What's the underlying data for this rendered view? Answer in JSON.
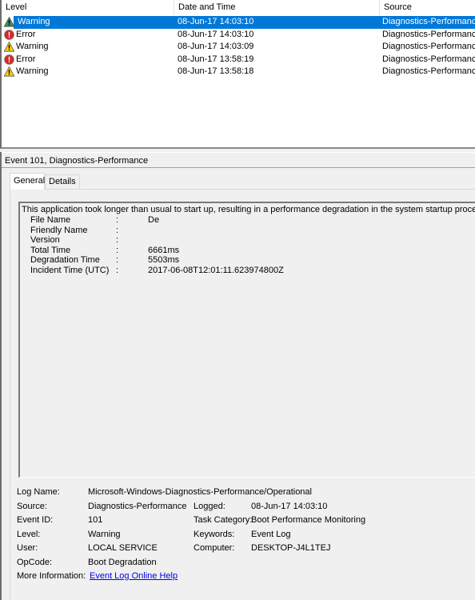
{
  "event_list": {
    "columns": [
      "Level",
      "Date and Time",
      "Source"
    ],
    "rows": [
      {
        "level": "Warning",
        "icon": "warning-icon",
        "date": "08-Jun-17 14:03:10",
        "source": "Diagnostics-Performance",
        "selected": true
      },
      {
        "level": "Error",
        "icon": "error-icon",
        "date": "08-Jun-17 14:03:10",
        "source": "Diagnostics-Performance",
        "selected": false
      },
      {
        "level": "Warning",
        "icon": "warning-icon",
        "date": "08-Jun-17 14:03:09",
        "source": "Diagnostics-Performance",
        "selected": false
      },
      {
        "level": "Error",
        "icon": "error-icon",
        "date": "08-Jun-17 13:58:19",
        "source": "Diagnostics-Performance",
        "selected": false
      },
      {
        "level": "Warning",
        "icon": "warning-icon",
        "date": "08-Jun-17 13:58:18",
        "source": "Diagnostics-Performance",
        "selected": false
      }
    ]
  },
  "detail": {
    "title": "Event 101, Diagnostics-Performance",
    "tabs": [
      {
        "label": "General",
        "active": true
      },
      {
        "label": "Details",
        "active": false
      }
    ],
    "description": {
      "intro": "This application took longer than usual to start up, resulting in a performance degradation in the system startup process:",
      "fields": [
        {
          "name": "File Name",
          "sep": ":",
          "value": "De"
        },
        {
          "name": "Friendly Name",
          "sep": ":",
          "value": ""
        },
        {
          "name": "Version",
          "sep": ":",
          "value": ""
        },
        {
          "name": "Total Time",
          "sep": ":",
          "value": "6661ms"
        },
        {
          "name": "Degradation Time",
          "sep": ":",
          "value": "5503ms"
        },
        {
          "name": "Incident Time (UTC)",
          "sep": ":",
          "value": "2017-06-08T12:01:11.623974800Z"
        }
      ]
    },
    "properties": {
      "log_name_label": "Log Name:",
      "log_name": "Microsoft-Windows-Diagnostics-Performance/Operational",
      "source_label": "Source:",
      "source": "Diagnostics-Performance",
      "logged_label": "Logged:",
      "logged": "08-Jun-17 14:03:10",
      "event_id_label": "Event ID:",
      "event_id": "101",
      "task_category_label": "Task Category:",
      "task_category": "Boot Performance Monitoring",
      "level_label": "Level:",
      "level": "Warning",
      "keywords_label": "Keywords:",
      "keywords": "Event Log",
      "user_label": "User:",
      "user": "LOCAL SERVICE",
      "computer_label": "Computer:",
      "computer": "DESKTOP-J4L1TEJ",
      "opcode_label": "OpCode:",
      "opcode": "Boot Degradation",
      "more_info_label": "More Information:",
      "more_info_link": "Event Log Online Help"
    }
  },
  "colors": {
    "selection": "#0078d7",
    "warning": "#f5d20a",
    "warning_selected": "#3a8c5c",
    "error": "#d22a2a",
    "link": "#0000ee"
  }
}
